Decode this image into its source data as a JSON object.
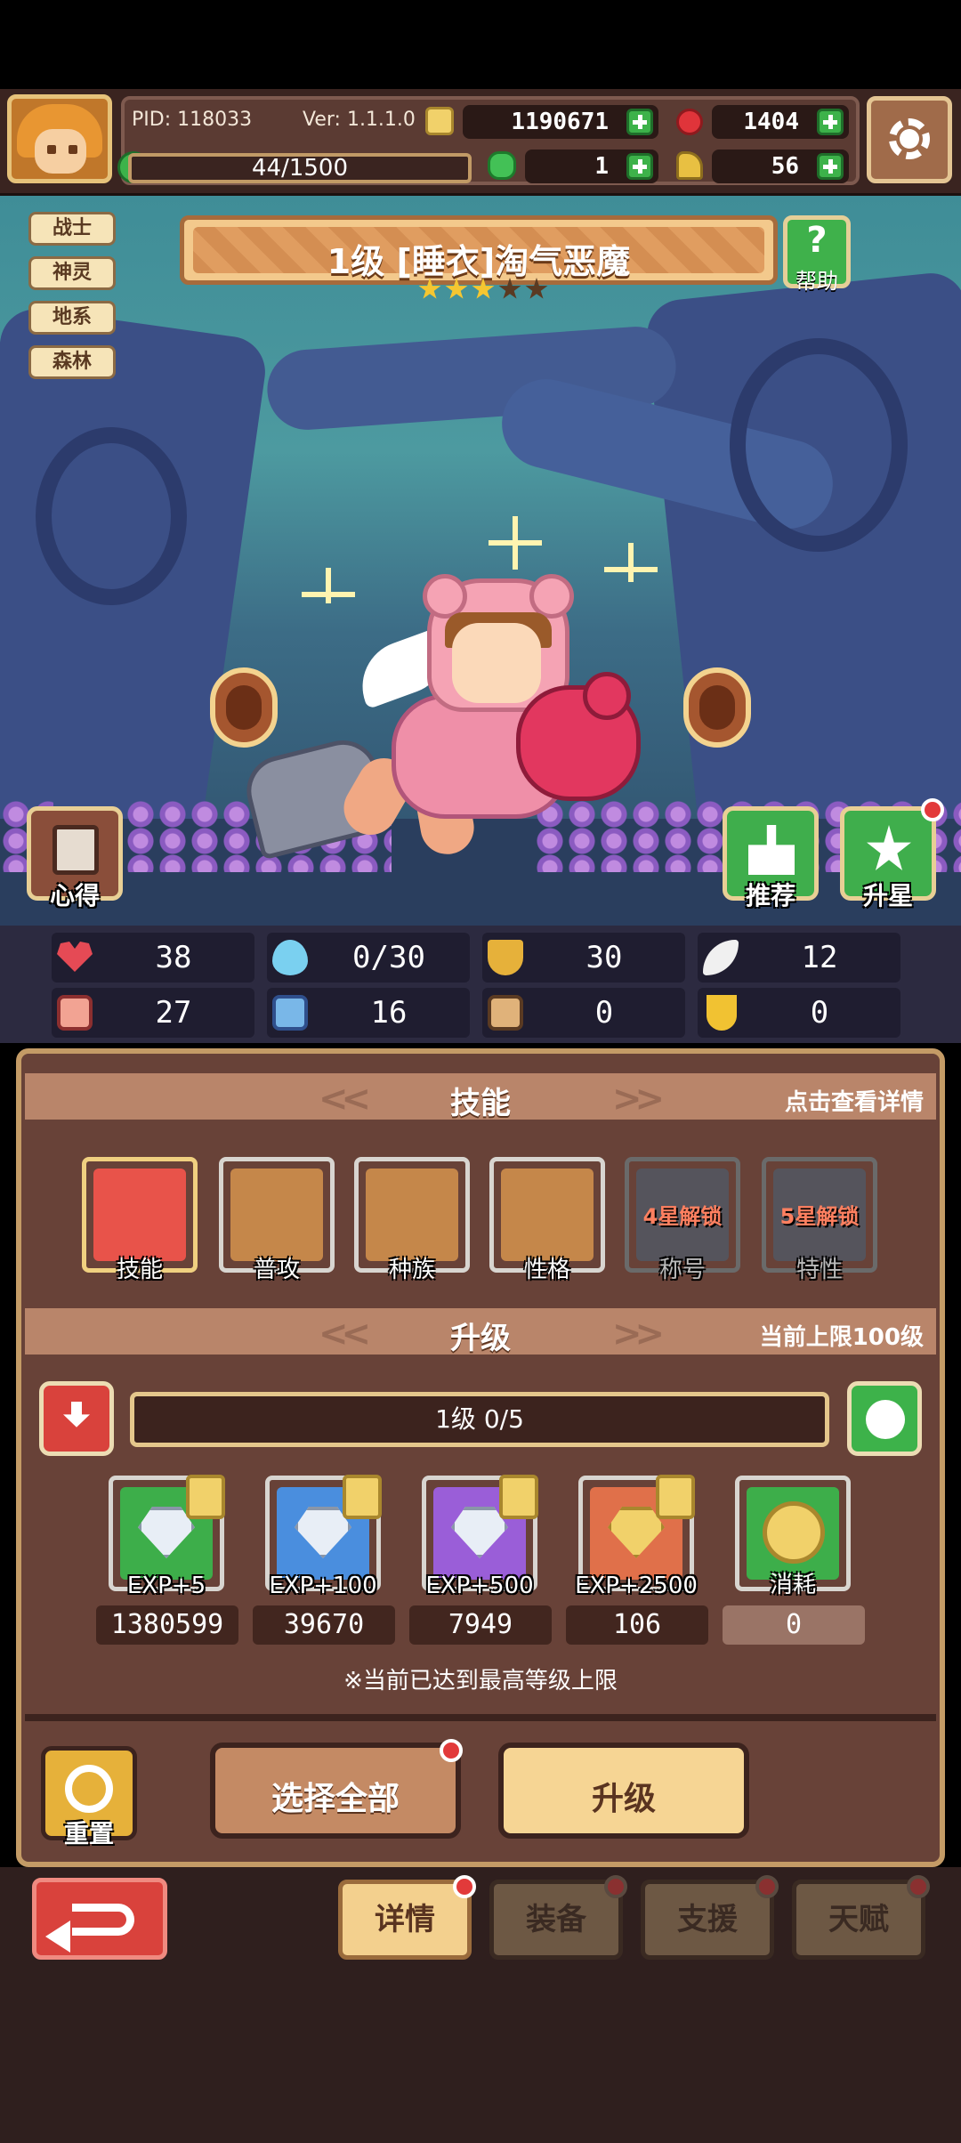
{
  "hud": {
    "pid": "PID: 118033",
    "version": "Ver: 1.1.1.0",
    "gold": "1190671",
    "ruby": "1404",
    "xp": "44/1500",
    "clover": "1",
    "horn": "56"
  },
  "hero": {
    "tags": [
      "战士",
      "神灵",
      "地系",
      "森林"
    ],
    "title": "1级 [睡衣]淘气恶魔",
    "stars": 3,
    "stars_max": 5,
    "help_label": "帮助",
    "?": "?",
    "left_button": "心得",
    "recommend_button": "推荐",
    "upgrade_star_button": "升星"
  },
  "stats": [
    {
      "icon": "heart-icon",
      "value": "38"
    },
    {
      "icon": "mana-drop-icon",
      "value": "0/30"
    },
    {
      "icon": "shield-icon",
      "value": "30"
    },
    {
      "icon": "wing-icon",
      "value": "12"
    },
    {
      "icon": "fist-icon",
      "value": "27"
    },
    {
      "icon": "book-icon",
      "value": "16"
    },
    {
      "icon": "boot-icon",
      "value": "0"
    },
    {
      "icon": "horseshoe-icon",
      "value": "0"
    }
  ],
  "skills_section": {
    "title": "技能",
    "hint": "点击查看详情",
    "items": [
      {
        "label": "技能",
        "lock": ""
      },
      {
        "label": "普攻",
        "lock": ""
      },
      {
        "label": "种族",
        "lock": ""
      },
      {
        "label": "性格",
        "lock": ""
      },
      {
        "label": "称号",
        "lock": "4星解锁"
      },
      {
        "label": "特性",
        "lock": "5星解锁"
      }
    ]
  },
  "upgrade_section": {
    "title": "升级",
    "hint": "当前上限100级",
    "level_text": "1级 0/5",
    "items": [
      {
        "label": "EXP+5",
        "count": "1380599"
      },
      {
        "label": "EXP+100",
        "count": "39670"
      },
      {
        "label": "EXP+500",
        "count": "7949"
      },
      {
        "label": "EXP+2500",
        "count": "106"
      },
      {
        "label": "消耗",
        "count": "0"
      }
    ],
    "notice": "※当前已达到最高等级上限"
  },
  "actions": {
    "reset": "重置",
    "select_all": "选择全部",
    "upgrade": "升级"
  },
  "tabs": [
    "详情",
    "装备",
    "支援",
    "天赋"
  ],
  "colors": {
    "gold": "#f1d16a",
    "ruby": "#e0343a",
    "green": "#3db24a",
    "badge_red": "#e23a3a"
  }
}
